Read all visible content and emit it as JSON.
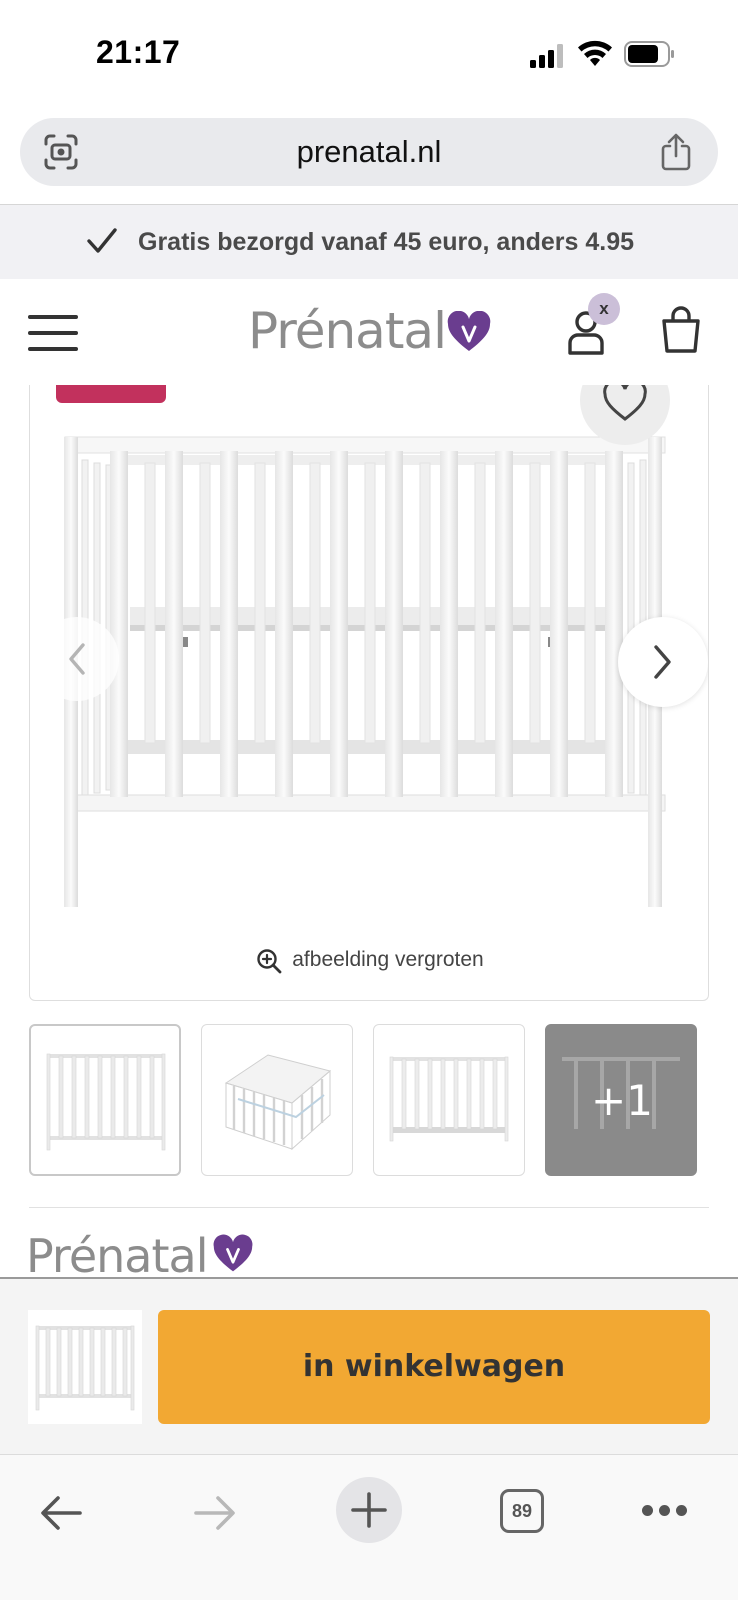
{
  "status_bar": {
    "time": "21:17",
    "icons": [
      "cellular-signal-icon",
      "wifi-icon",
      "battery-icon"
    ]
  },
  "browser": {
    "url": "prenatal.nl",
    "left_icon": "screenshot-scan-icon",
    "right_icon": "share-icon",
    "tab_count": "89"
  },
  "promo": {
    "icon": "checkmark-icon",
    "text": "Gratis bezorgd vanaf 45 euro, anders 4.95"
  },
  "header": {
    "logo_text": "Prénatal",
    "account_badge": "x",
    "icons": [
      "hamburger-menu-icon",
      "heart-logo-icon",
      "account-icon",
      "shopping-bag-icon"
    ]
  },
  "product_gallery": {
    "zoom_label": "afbeelding vergroten",
    "more_images_label": "+1",
    "thumbnail_count_visible": 4
  },
  "brand": {
    "logo_text": "Prénatal"
  },
  "sticky_cart": {
    "button_label": "in winkelwagen"
  },
  "colors": {
    "brand_purple": "#6a3d8f",
    "sale_pink": "#c2315d",
    "cart_orange": "#f2a833",
    "promo_bg": "#f1f1f4"
  }
}
